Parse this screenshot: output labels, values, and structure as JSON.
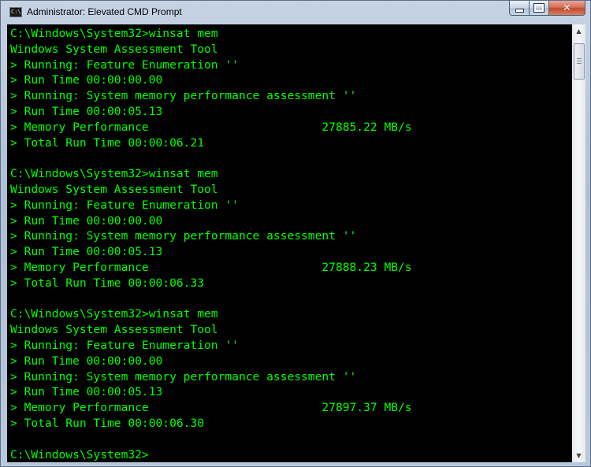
{
  "window": {
    "title": "Administrator: Elevated CMD Prompt",
    "app_icon_text": "C:\\"
  },
  "caption_buttons": {
    "minimize": "minimize-icon",
    "maximize": "maximize-icon",
    "close": "close-icon",
    "close_glyph": "✕"
  },
  "console": {
    "text_color": "#00ff00",
    "background": "#000000",
    "lines": [
      "C:\\Windows\\System32>winsat mem",
      "Windows System Assessment Tool",
      "> Running: Feature Enumeration ''",
      "> Run Time 00:00:00.00",
      "> Running: System memory performance assessment ''",
      "> Run Time 00:00:05.13",
      "> Memory Performance                         27885.22 MB/s",
      "> Total Run Time 00:00:06.21",
      "",
      "C:\\Windows\\System32>winsat mem",
      "Windows System Assessment Tool",
      "> Running: Feature Enumeration ''",
      "> Run Time 00:00:00.00",
      "> Running: System memory performance assessment ''",
      "> Run Time 00:00:05.13",
      "> Memory Performance                         27888.23 MB/s",
      "> Total Run Time 00:00:06.33",
      "",
      "C:\\Windows\\System32>winsat mem",
      "Windows System Assessment Tool",
      "> Running: Feature Enumeration ''",
      "> Run Time 00:00:00.00",
      "> Running: System memory performance assessment ''",
      "> Run Time 00:00:05.13",
      "> Memory Performance                         27897.37 MB/s",
      "> Total Run Time 00:00:06.30",
      "",
      "C:\\Windows\\System32>"
    ]
  },
  "scrollbar": {
    "up_arrow": "▲",
    "down_arrow": "▼"
  }
}
